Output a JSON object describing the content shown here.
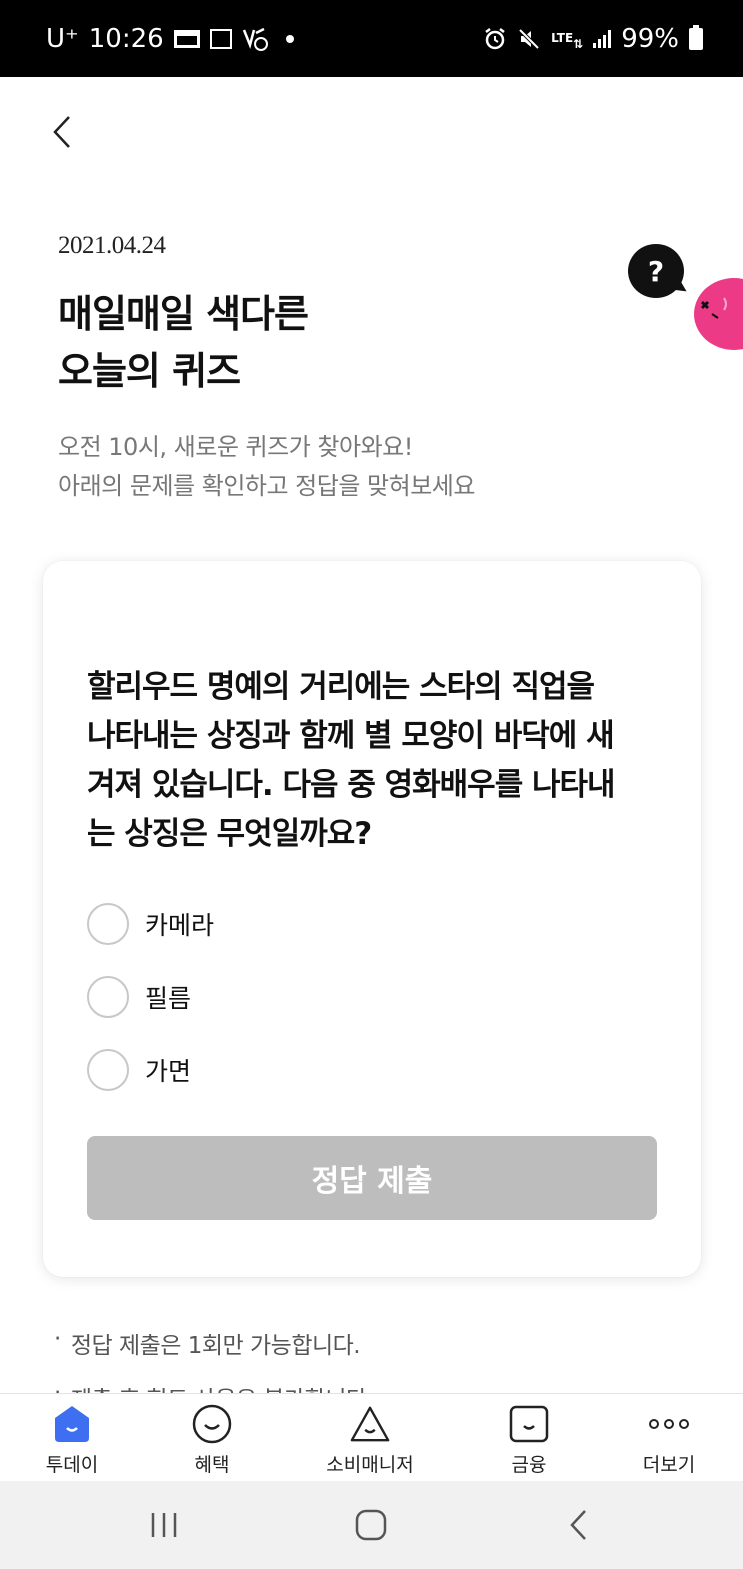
{
  "status_bar": {
    "carrier": "U⁺",
    "time": "10:26",
    "network": "LTE",
    "battery": "99%"
  },
  "quiz": {
    "date": "2021.04.24",
    "title_line1": "매일매일 색다른",
    "title_line2": "오늘의 퀴즈",
    "subtitle_line1": "오전 10시, 새로운 퀴즈가 찾아와요!",
    "subtitle_line2": "아래의 문제를 확인하고 정답을 맞혀보세요",
    "help_mark": "?",
    "question_lines": [
      "할리우드 명예의 거리에는 스타의 직업을",
      "나타내는 상징과 함께 별 모양이 바닥에 새",
      "겨져 있습니다. 다음 중 영화배우를 나타내",
      "는 상징은 무엇일까요?"
    ],
    "options": [
      "카메라",
      "필름",
      "가면"
    ],
    "submit_label": "정답 제출"
  },
  "notes": {
    "bullet": "·",
    "items": [
      "정답 제출은 1회만 가능합니다.",
      "제출 후 힌트 사용은 불가합니다."
    ]
  },
  "tabbar": {
    "items": [
      {
        "label": "투데이",
        "icon": "today-icon",
        "active": true
      },
      {
        "label": "혜택",
        "icon": "smile-icon"
      },
      {
        "label": "소비매니저",
        "icon": "triangle-smile-icon"
      },
      {
        "label": "금융",
        "icon": "wallet-smile-icon"
      },
      {
        "label": "더보기",
        "icon": "more-dots-icon"
      }
    ]
  },
  "colors": {
    "accent_blue": "#3d6ff0",
    "button_disabled": "#bdbdbd",
    "mascot_pink": "#ec3a86"
  }
}
